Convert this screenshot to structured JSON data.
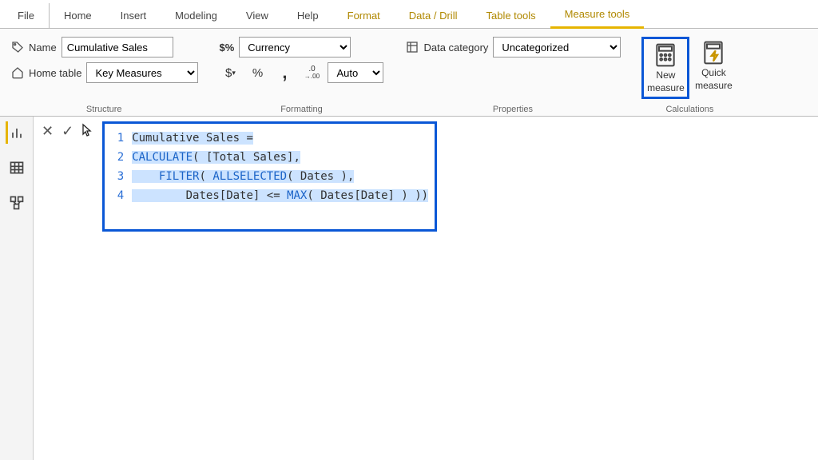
{
  "tabs": {
    "file": "File",
    "home": "Home",
    "insert": "Insert",
    "modeling": "Modeling",
    "view": "View",
    "help": "Help",
    "format": "Format",
    "data_drill": "Data / Drill",
    "table_tools": "Table tools",
    "measure_tools": "Measure tools"
  },
  "structure": {
    "name_label": "Name",
    "name_value": "Cumulative Sales",
    "home_table_label": "Home table",
    "home_table_value": "Key Measures",
    "group_label": "Structure"
  },
  "formatting": {
    "format_label": "$%",
    "format_value": "Currency",
    "dollar": "$",
    "percent": "%",
    "comma": ",",
    "dec_inc": ".00",
    "dec_dec": ".0",
    "auto": "Auto",
    "group_label": "Formatting"
  },
  "properties": {
    "data_category_label": "Data category",
    "data_category_value": "Uncategorized",
    "group_label": "Properties"
  },
  "calculations": {
    "new_measure_l1": "New",
    "new_measure_l2": "measure",
    "quick_measure_l1": "Quick",
    "quick_measure_l2": "measure",
    "group_label": "Calculations"
  },
  "fx": {
    "discard": "✕",
    "commit": "✓"
  },
  "code": {
    "l1_gutter": "1",
    "l1_text": "Cumulative Sales =",
    "l2_gutter": "2",
    "l2_kw": "CALCULATE",
    "l2_rest": "( [Total Sales],",
    "l3_gutter": "3",
    "l3_pad": "    ",
    "l3_kw1": "FILTER",
    "l3_mid": "( ",
    "l3_kw2": "ALLSELECTED",
    "l3_rest": "( Dates ),",
    "l4_gutter": "4",
    "l4_pad": "        ",
    "l4_a": "Dates[Date] <= ",
    "l4_kw": "MAX",
    "l4_b": "( Dates[Date] ) ))"
  }
}
